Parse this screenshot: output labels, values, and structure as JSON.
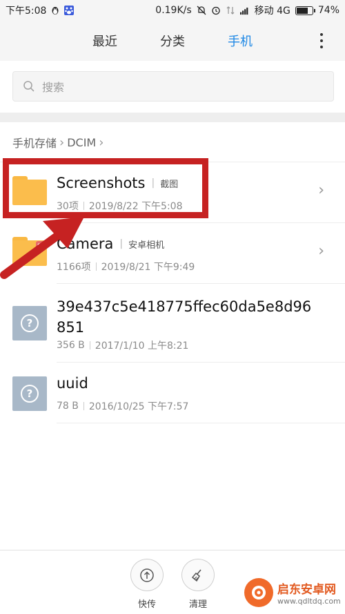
{
  "status_bar": {
    "time": "下午5:08",
    "speed": "0.19K/s",
    "carrier": "移动 4G",
    "battery": "74%",
    "battery_level": 0.74
  },
  "tabs": [
    {
      "label": "最近",
      "active": false
    },
    {
      "label": "分类",
      "active": false
    },
    {
      "label": "手机",
      "active": true
    }
  ],
  "search": {
    "placeholder": "搜索"
  },
  "breadcrumb": [
    "手机存储",
    "DCIM"
  ],
  "files": [
    {
      "name": "Screenshots",
      "tag": "截图",
      "count": "30项",
      "date": "2019/8/22 下午5:08",
      "type": "folder"
    },
    {
      "name": "Camera",
      "tag": "安卓相机",
      "count": "1166项",
      "date": "2019/8/21 下午9:49",
      "type": "folder"
    },
    {
      "name": "39e437c5e418775ffec60da5e8d96",
      "name_line2": "851",
      "size": "356 B",
      "date": "2017/1/10 上午8:21",
      "type": "file"
    },
    {
      "name": "uuid",
      "size": "78 B",
      "date": "2016/10/25 下午7:57",
      "type": "file"
    }
  ],
  "bottom_actions": [
    {
      "label": "快传",
      "icon": "upload-icon"
    },
    {
      "label": "清理",
      "icon": "broom-icon"
    }
  ],
  "watermark": {
    "title": "启东安卓网",
    "url": "www.qdltdq.com"
  },
  "colors": {
    "accent": "#1e88e5",
    "annotation": "#c62222",
    "folder": "#fbbd4c"
  }
}
